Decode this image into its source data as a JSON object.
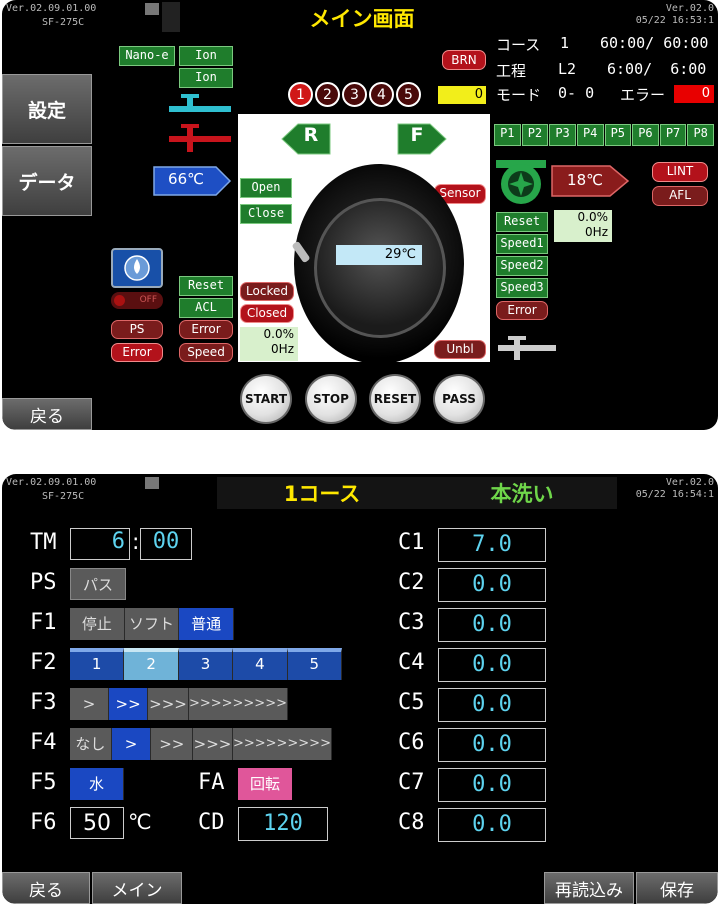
{
  "main": {
    "version": "Ver.02.09.01.00",
    "model": "SF-275C",
    "version_right": "Ver.02.0",
    "datetime": "05/22 16:53:1",
    "title": "メイン画面",
    "left_menu": {
      "settings": "設定",
      "data": "データ",
      "back": "戻る"
    },
    "nano_e": "Nano-e",
    "ion1": "Ion",
    "ion2": "Ion",
    "temp_left": "66℃",
    "brn": "BRN",
    "steps": [
      "1",
      "2",
      "3",
      "4",
      "5"
    ],
    "step_value": "0",
    "rev_label": "R",
    "fwd_label": "F",
    "door_open": "Open",
    "door_close": "Close",
    "sensor": "Sensor",
    "drum_temp": "29℃",
    "locked": "Locked",
    "closed": "Closed",
    "motor_pct": "0.0%",
    "motor_hz": "0Hz",
    "unbl": "Unbl",
    "water_off": "OFF",
    "ps": "PS",
    "error_left": "Error",
    "reset_left": "Reset",
    "acl": "ACL",
    "error_mid": "Error",
    "speed_mid": "Speed",
    "info": {
      "course_label": "コース",
      "course_no": "1",
      "course_time": "60:00/ 60:00",
      "step_label": "工程",
      "step_no": "L2",
      "step_time": "6:00/  6:00",
      "mode_label": "モード",
      "mode_value": "0- 0",
      "error_label": "エラー",
      "error_value": "0"
    },
    "p_buttons": [
      "P1",
      "P2",
      "P3",
      "P4",
      "P5",
      "P6",
      "P7",
      "P8"
    ],
    "temp_right": "18℃",
    "lint": "LINT",
    "afl": "AFL",
    "fan_reset": "Reset",
    "fan_speed1": "Speed1",
    "fan_speed2": "Speed2",
    "fan_speed3": "Speed3",
    "fan_error": "Error",
    "fan_pct": "0.0%",
    "fan_hz": "0Hz",
    "bottom_buttons": [
      "START",
      "STOP",
      "RESET",
      "PASS"
    ]
  },
  "course": {
    "version": "Ver.02.09.01.00",
    "model": "SF-275C",
    "version_right": "Ver.02.0",
    "datetime": "05/22 16:54:1",
    "title": "1コース",
    "subtitle": "本洗い",
    "tm_label": "TM",
    "tm_min": "6",
    "tm_sep": ":",
    "tm_sec": "00",
    "ps_label": "PS",
    "ps_value": "パス",
    "f1_label": "F1",
    "f1_options": [
      "停止",
      "ソフト",
      "普通"
    ],
    "f1_selected": 2,
    "f2_label": "F2",
    "f2_options": [
      "1",
      "2",
      "3",
      "4",
      "5"
    ],
    "f2_selected": 1,
    "f3_label": "F3",
    "f3_options": [
      ">",
      ">>",
      ">>>",
      ">>>>>>>>>"
    ],
    "f3_selected": 1,
    "f4_label": "F4",
    "f4_options": [
      "なし",
      ">",
      ">>",
      ">>>",
      ">>>>>>>>>"
    ],
    "f4_selected": 1,
    "f5_label": "F5",
    "f5_value": "水",
    "fa_label": "FA",
    "fa_value": "回転",
    "f6_label": "F6",
    "f6_value": "50",
    "f6_unit": "℃",
    "cd_label": "CD",
    "cd_value": "120",
    "channels": [
      {
        "label": "C1",
        "value": "7.0"
      },
      {
        "label": "C2",
        "value": "0.0"
      },
      {
        "label": "C3",
        "value": "0.0"
      },
      {
        "label": "C4",
        "value": "0.0"
      },
      {
        "label": "C5",
        "value": "0.0"
      },
      {
        "label": "C6",
        "value": "0.0"
      },
      {
        "label": "C7",
        "value": "0.0"
      },
      {
        "label": "C8",
        "value": "0.0"
      }
    ],
    "footer": {
      "back": "戻る",
      "main": "メイン",
      "reload": "再読込み",
      "save": "保存"
    },
    "colors": {
      "accent_yellow": "#ffe800",
      "accent_green": "#6fd64a",
      "value_cyan": "#5ed3ef",
      "selected_blue": "#1a48c2",
      "fa_pink": "#e0569a"
    }
  }
}
